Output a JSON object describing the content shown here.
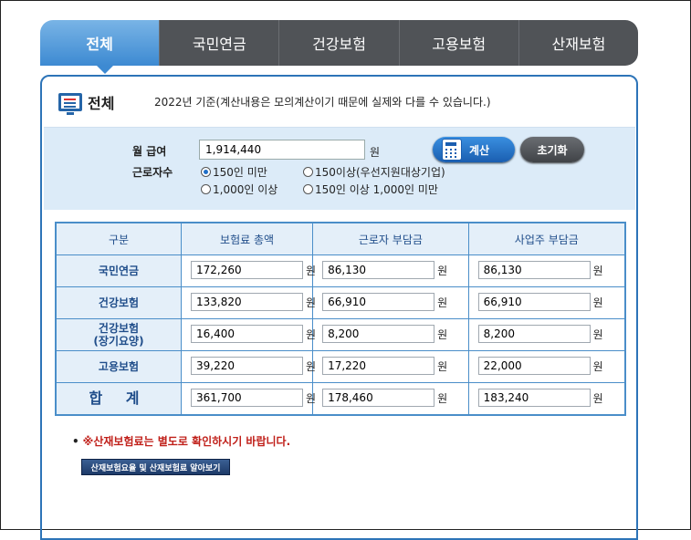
{
  "tabs": [
    "전체",
    "국민연금",
    "건강보험",
    "고용보험",
    "산재보험"
  ],
  "header": {
    "title": "전체",
    "note": "2022년 기준(계산내용은 모의계산이기 때문에 실제와 다를 수 있습니다.)"
  },
  "form": {
    "salary_label": "월 급여",
    "salary_value": "1,914,440",
    "unit": "원",
    "workers_label": "근로자수",
    "options": [
      "150인 미만",
      "150이상(우선지원대상기업)",
      "1,000인 이상",
      "150인 이상 1,000인 미만"
    ],
    "selected_option": "150인 미만",
    "calc_button": "계산",
    "reset_button": "초기화"
  },
  "table": {
    "headers": [
      "구분",
      "보험료 총액",
      "근로자 부담금",
      "사업주 부담금"
    ],
    "rows": [
      {
        "label": "국민연금",
        "total": "172,260",
        "worker": "86,130",
        "employer": "86,130"
      },
      {
        "label": "건강보험",
        "total": "133,820",
        "worker": "66,910",
        "employer": "66,910"
      },
      {
        "label": "건강보험",
        "label2": "(장기요양)",
        "total": "16,400",
        "worker": "8,200",
        "employer": "8,200"
      },
      {
        "label": "고용보험",
        "total": "39,220",
        "worker": "17,220",
        "employer": "22,000"
      },
      {
        "label": "합 계",
        "total": "361,700",
        "worker": "178,460",
        "employer": "183,240"
      }
    ],
    "unit": "원"
  },
  "notice": {
    "bullet": "•",
    "text": "※산재보험료는 별도로 확인하시기 바랍니다."
  },
  "link_button": "산재보험요율 및 산재보험료 알아보기",
  "colors": {
    "active_tab": "#3d8ad2",
    "inactive_tab": "#505357",
    "border": "#2d74b8",
    "notice": "#c0201a"
  }
}
